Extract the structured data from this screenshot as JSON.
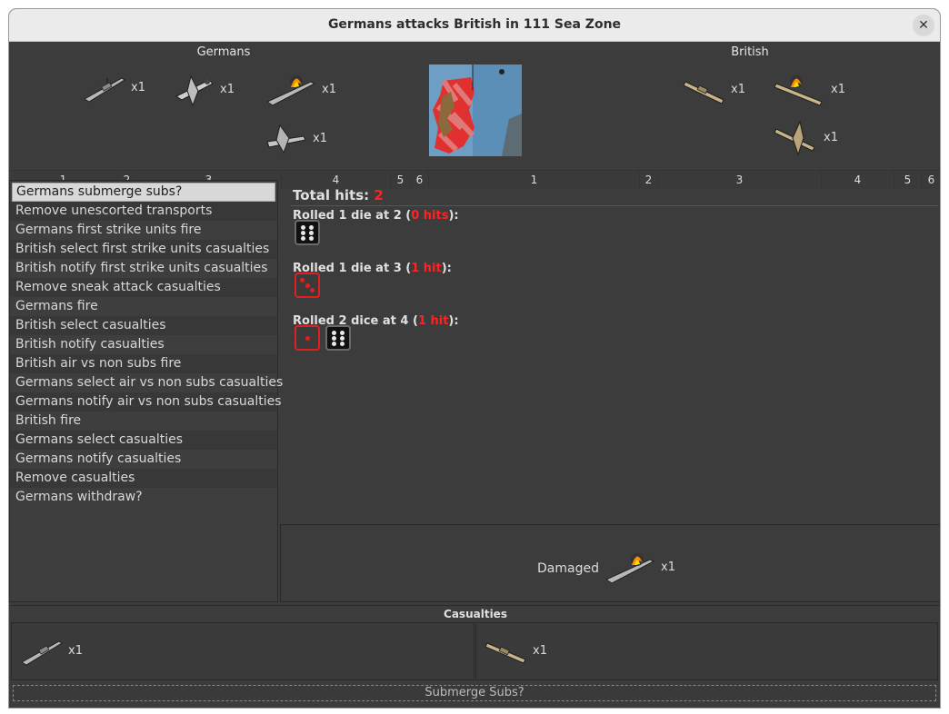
{
  "window": {
    "title": "Germans attacks British in 111 Sea Zone"
  },
  "attacker": {
    "label": "Germans",
    "units": [
      {
        "icon": "battleship-icon",
        "count": "x1"
      },
      {
        "icon": "fighter-icon",
        "count": "x1"
      },
      {
        "icon": "damaged-battleship-icon",
        "count": "x1"
      },
      {
        "icon": "bomber-icon",
        "count": "x1"
      }
    ],
    "dice_columns": [
      "1",
      "2",
      "3",
      "4",
      "5",
      "6"
    ]
  },
  "defender": {
    "label": "British",
    "units": [
      {
        "icon": "battleship-icon",
        "count": "x1"
      },
      {
        "icon": "damaged-battleship-icon",
        "count": "x1"
      },
      {
        "icon": "fighter-icon",
        "count": "x1"
      }
    ],
    "dice_columns": [
      "1",
      "2",
      "3",
      "4",
      "5",
      "6"
    ]
  },
  "steps": [
    "Germans submerge subs?",
    "Remove unescorted transports",
    "Germans first strike units fire",
    "British select first strike units casualties",
    "British notify first strike units casualties",
    "Remove sneak attack casualties",
    "Germans fire",
    "British select casualties",
    "British notify casualties",
    "British air vs non subs fire",
    "Germans select air vs non subs casualties",
    "Germans notify air vs non subs casualties",
    "British fire",
    "Germans select casualties",
    "Germans notify casualties",
    "Remove casualties",
    "Germans withdraw?"
  ],
  "rolls": {
    "total_label": "Total hits: ",
    "total_value": "2",
    "groups": [
      {
        "prefix": "Rolled 1 die at 2 (",
        "hits": "0 hits",
        "suffix": "):",
        "dice": [
          {
            "value": 6,
            "hit": false
          }
        ]
      },
      {
        "prefix": "Rolled 1 die at 3 (",
        "hits": "1 hit",
        "suffix": "):",
        "dice": [
          {
            "value": 3,
            "hit": true
          }
        ]
      },
      {
        "prefix": "Rolled 2 dice at 4 (",
        "hits": "1 hit",
        "suffix": "):",
        "dice": [
          {
            "value": 1,
            "hit": true
          },
          {
            "value": 6,
            "hit": false
          }
        ]
      }
    ]
  },
  "damaged": {
    "label": "Damaged",
    "count": "x1"
  },
  "casualties": {
    "title": "Casualties",
    "attacker": {
      "count": "x1"
    },
    "defender": {
      "count": "x1"
    }
  },
  "action_button": "Submerge Subs?",
  "colors": {
    "hit_red": "#ff2222",
    "panel_bg": "#3c3c3c",
    "german_grey": "#b8b8b8",
    "british_tan": "#c8b488"
  }
}
